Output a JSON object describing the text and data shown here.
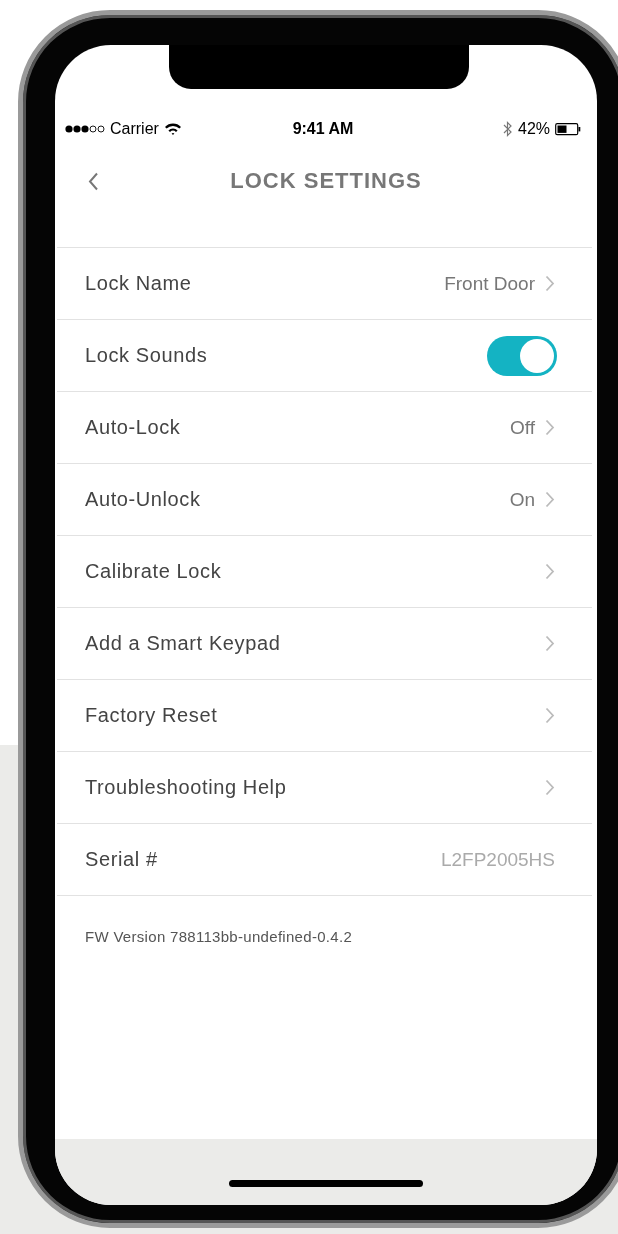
{
  "status_bar": {
    "carrier": "Carrier",
    "time": "9:41 AM",
    "battery": "42%"
  },
  "nav": {
    "title": "LOCK SETTINGS"
  },
  "rows": [
    {
      "kind": "value",
      "label": "Lock Name",
      "value": "Front Door"
    },
    {
      "kind": "toggle",
      "label": "Lock Sounds",
      "on": true
    },
    {
      "kind": "value",
      "label": "Auto-Lock",
      "value": "Off"
    },
    {
      "kind": "value",
      "label": "Auto-Unlock",
      "value": "On"
    },
    {
      "kind": "link",
      "label": "Calibrate Lock"
    },
    {
      "kind": "link",
      "label": "Add a Smart Keypad"
    },
    {
      "kind": "link",
      "label": "Factory Reset"
    },
    {
      "kind": "link",
      "label": "Troubleshooting Help"
    },
    {
      "kind": "info",
      "label": "Serial #",
      "value": "L2FP2005HS"
    }
  ],
  "footer": {
    "firmware": "FW Version 788113bb-undefined-0.4.2"
  }
}
